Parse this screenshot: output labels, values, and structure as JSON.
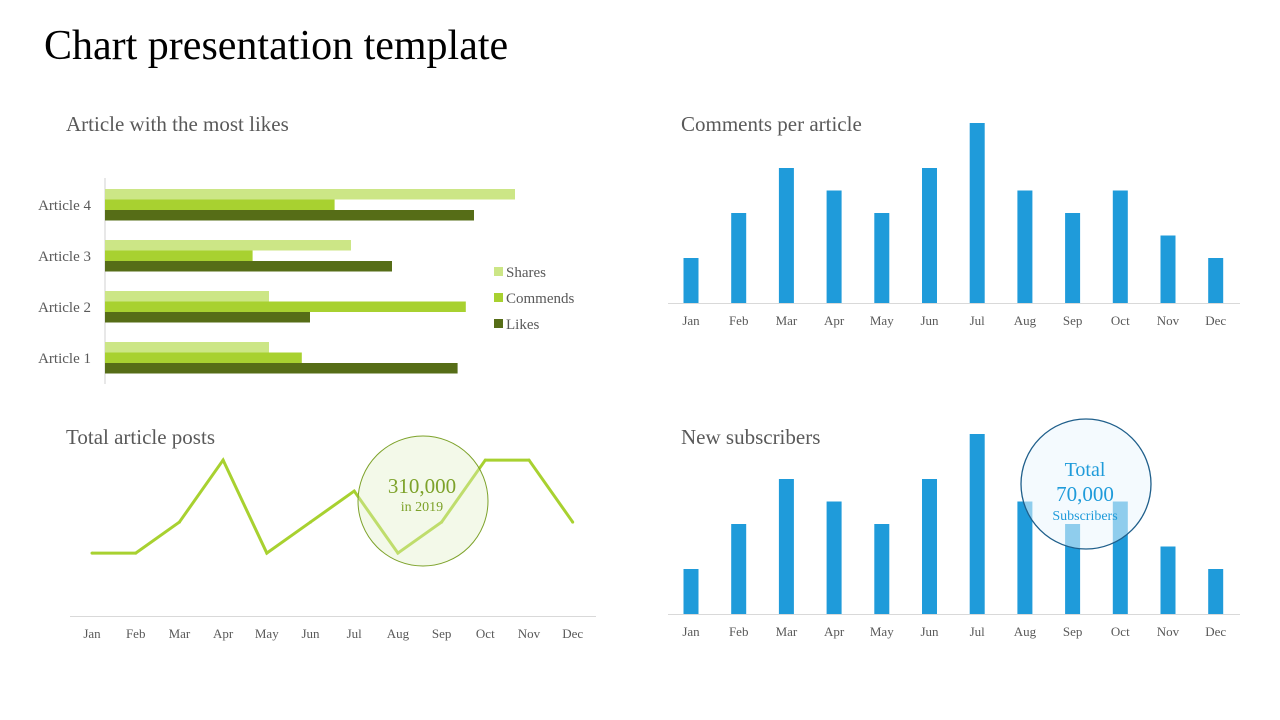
{
  "slide": {
    "title": "Chart presentation template"
  },
  "colors": {
    "shares": "#cce686",
    "commends": "#a8d130",
    "likes": "#566d17",
    "blue": "#1f9bda",
    "line": "#a8d130"
  },
  "chart_data": [
    {
      "type": "bar",
      "orientation": "horizontal",
      "title": "Article with the most likes",
      "categories": [
        "Article 1",
        "Article 2",
        "Article 3",
        "Article 4"
      ],
      "series": [
        {
          "name": "Shares",
          "values": [
            2.0,
            2.0,
            3.0,
            5.0
          ]
        },
        {
          "name": "Commends",
          "values": [
            2.4,
            4.4,
            1.8,
            2.8
          ]
        },
        {
          "name": "Likes",
          "values": [
            4.3,
            2.5,
            3.5,
            4.5
          ]
        }
      ],
      "xlim": [
        0,
        5
      ],
      "legend": "right",
      "grid": false
    },
    {
      "type": "bar",
      "title": "Comments per article",
      "categories": [
        "Jan",
        "Feb",
        "Mar",
        "Apr",
        "May",
        "Jun",
        "Jul",
        "Aug",
        "Sep",
        "Oct",
        "Nov",
        "Dec"
      ],
      "values": [
        2,
        4,
        6,
        5,
        4,
        6,
        8,
        5,
        4,
        5,
        3,
        2
      ],
      "ylim": [
        0,
        8
      ],
      "grid": false
    },
    {
      "type": "line",
      "title": "Total article posts",
      "categories": [
        "Jan",
        "Feb",
        "Mar",
        "Apr",
        "May",
        "Jun",
        "Jul",
        "Aug",
        "Sep",
        "Oct",
        "Nov",
        "Dec"
      ],
      "values": [
        2,
        2,
        3,
        5,
        2,
        3,
        4,
        2,
        3,
        5,
        5,
        3
      ],
      "ylim": [
        0,
        5
      ],
      "grid": false,
      "annotation": {
        "value": "310,000",
        "caption": "in 2019"
      }
    },
    {
      "type": "bar",
      "title": "New subscribers",
      "categories": [
        "Jan",
        "Feb",
        "Mar",
        "Apr",
        "May",
        "Jun",
        "Jul",
        "Aug",
        "Sep",
        "Oct",
        "Nov",
        "Dec"
      ],
      "values": [
        2,
        4,
        6,
        5,
        4,
        6,
        8,
        5,
        4,
        5,
        3,
        2
      ],
      "ylim": [
        0,
        8
      ],
      "grid": false,
      "annotation": {
        "line1": "Total",
        "value": "70,000",
        "caption": "Subscribers"
      }
    }
  ]
}
